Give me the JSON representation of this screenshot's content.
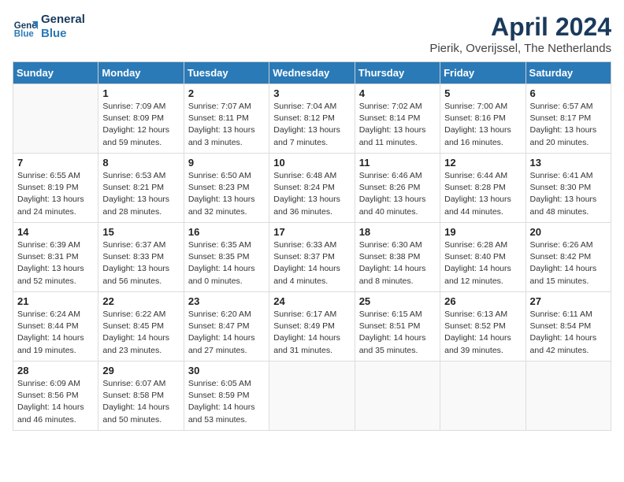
{
  "header": {
    "logo_line1": "General",
    "logo_line2": "Blue",
    "month": "April 2024",
    "location": "Pierik, Overijssel, The Netherlands"
  },
  "columns": [
    "Sunday",
    "Monday",
    "Tuesday",
    "Wednesday",
    "Thursday",
    "Friday",
    "Saturday"
  ],
  "weeks": [
    [
      {
        "day": "",
        "info": ""
      },
      {
        "day": "1",
        "info": "Sunrise: 7:09 AM\nSunset: 8:09 PM\nDaylight: 12 hours\nand 59 minutes."
      },
      {
        "day": "2",
        "info": "Sunrise: 7:07 AM\nSunset: 8:11 PM\nDaylight: 13 hours\nand 3 minutes."
      },
      {
        "day": "3",
        "info": "Sunrise: 7:04 AM\nSunset: 8:12 PM\nDaylight: 13 hours\nand 7 minutes."
      },
      {
        "day": "4",
        "info": "Sunrise: 7:02 AM\nSunset: 8:14 PM\nDaylight: 13 hours\nand 11 minutes."
      },
      {
        "day": "5",
        "info": "Sunrise: 7:00 AM\nSunset: 8:16 PM\nDaylight: 13 hours\nand 16 minutes."
      },
      {
        "day": "6",
        "info": "Sunrise: 6:57 AM\nSunset: 8:17 PM\nDaylight: 13 hours\nand 20 minutes."
      }
    ],
    [
      {
        "day": "7",
        "info": "Sunrise: 6:55 AM\nSunset: 8:19 PM\nDaylight: 13 hours\nand 24 minutes."
      },
      {
        "day": "8",
        "info": "Sunrise: 6:53 AM\nSunset: 8:21 PM\nDaylight: 13 hours\nand 28 minutes."
      },
      {
        "day": "9",
        "info": "Sunrise: 6:50 AM\nSunset: 8:23 PM\nDaylight: 13 hours\nand 32 minutes."
      },
      {
        "day": "10",
        "info": "Sunrise: 6:48 AM\nSunset: 8:24 PM\nDaylight: 13 hours\nand 36 minutes."
      },
      {
        "day": "11",
        "info": "Sunrise: 6:46 AM\nSunset: 8:26 PM\nDaylight: 13 hours\nand 40 minutes."
      },
      {
        "day": "12",
        "info": "Sunrise: 6:44 AM\nSunset: 8:28 PM\nDaylight: 13 hours\nand 44 minutes."
      },
      {
        "day": "13",
        "info": "Sunrise: 6:41 AM\nSunset: 8:30 PM\nDaylight: 13 hours\nand 48 minutes."
      }
    ],
    [
      {
        "day": "14",
        "info": "Sunrise: 6:39 AM\nSunset: 8:31 PM\nDaylight: 13 hours\nand 52 minutes."
      },
      {
        "day": "15",
        "info": "Sunrise: 6:37 AM\nSunset: 8:33 PM\nDaylight: 13 hours\nand 56 minutes."
      },
      {
        "day": "16",
        "info": "Sunrise: 6:35 AM\nSunset: 8:35 PM\nDaylight: 14 hours\nand 0 minutes."
      },
      {
        "day": "17",
        "info": "Sunrise: 6:33 AM\nSunset: 8:37 PM\nDaylight: 14 hours\nand 4 minutes."
      },
      {
        "day": "18",
        "info": "Sunrise: 6:30 AM\nSunset: 8:38 PM\nDaylight: 14 hours\nand 8 minutes."
      },
      {
        "day": "19",
        "info": "Sunrise: 6:28 AM\nSunset: 8:40 PM\nDaylight: 14 hours\nand 12 minutes."
      },
      {
        "day": "20",
        "info": "Sunrise: 6:26 AM\nSunset: 8:42 PM\nDaylight: 14 hours\nand 15 minutes."
      }
    ],
    [
      {
        "day": "21",
        "info": "Sunrise: 6:24 AM\nSunset: 8:44 PM\nDaylight: 14 hours\nand 19 minutes."
      },
      {
        "day": "22",
        "info": "Sunrise: 6:22 AM\nSunset: 8:45 PM\nDaylight: 14 hours\nand 23 minutes."
      },
      {
        "day": "23",
        "info": "Sunrise: 6:20 AM\nSunset: 8:47 PM\nDaylight: 14 hours\nand 27 minutes."
      },
      {
        "day": "24",
        "info": "Sunrise: 6:17 AM\nSunset: 8:49 PM\nDaylight: 14 hours\nand 31 minutes."
      },
      {
        "day": "25",
        "info": "Sunrise: 6:15 AM\nSunset: 8:51 PM\nDaylight: 14 hours\nand 35 minutes."
      },
      {
        "day": "26",
        "info": "Sunrise: 6:13 AM\nSunset: 8:52 PM\nDaylight: 14 hours\nand 39 minutes."
      },
      {
        "day": "27",
        "info": "Sunrise: 6:11 AM\nSunset: 8:54 PM\nDaylight: 14 hours\nand 42 minutes."
      }
    ],
    [
      {
        "day": "28",
        "info": "Sunrise: 6:09 AM\nSunset: 8:56 PM\nDaylight: 14 hours\nand 46 minutes."
      },
      {
        "day": "29",
        "info": "Sunrise: 6:07 AM\nSunset: 8:58 PM\nDaylight: 14 hours\nand 50 minutes."
      },
      {
        "day": "30",
        "info": "Sunrise: 6:05 AM\nSunset: 8:59 PM\nDaylight: 14 hours\nand 53 minutes."
      },
      {
        "day": "",
        "info": ""
      },
      {
        "day": "",
        "info": ""
      },
      {
        "day": "",
        "info": ""
      },
      {
        "day": "",
        "info": ""
      }
    ]
  ]
}
